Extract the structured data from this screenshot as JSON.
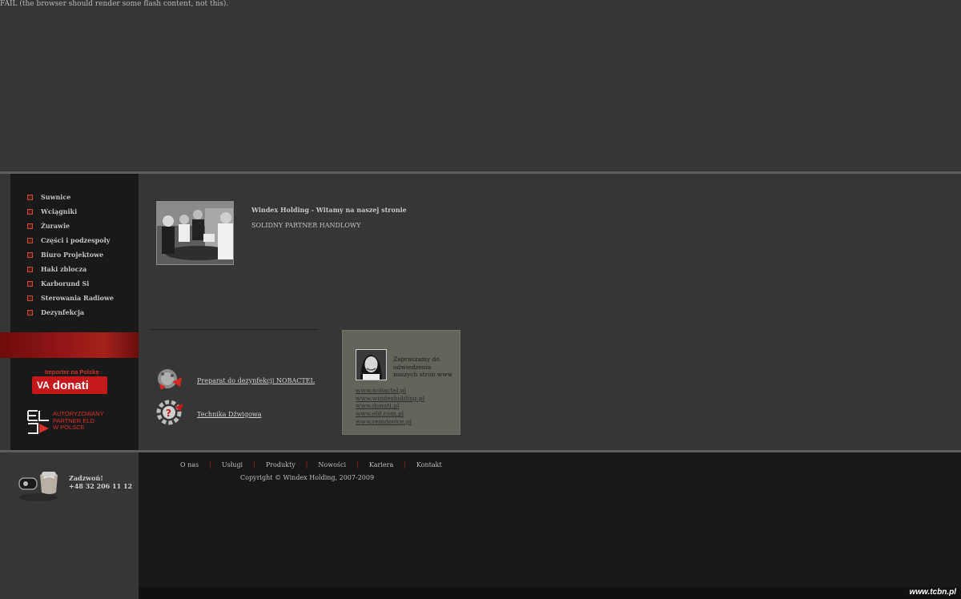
{
  "flash_notice": "FAIL (the browser should render some flash content, not this).",
  "sidebar": {
    "items": [
      {
        "label": "Suwnice"
      },
      {
        "label": "Wciągniki"
      },
      {
        "label": "Żurawie"
      },
      {
        "label": "Części i podzespoły"
      },
      {
        "label": "Biuro Projektowe"
      },
      {
        "label": "Haki zblocza"
      },
      {
        "label": "Karborund Si"
      },
      {
        "label": "Sterowania Radiowe"
      },
      {
        "label": "Dezynfekcja"
      }
    ],
    "donati": {
      "tagline": "Importer na Polskę",
      "wordmark": "donati",
      "mark": "VA"
    },
    "eld": {
      "line1": "AUTORYZOWANY",
      "line2": "PARTNER ELD",
      "line3": "W POLSCE"
    }
  },
  "welcome": {
    "title": "Windex Holding - Witamy na naszej stronie",
    "subtitle": "SOLIDNY PARTNER HANDLOWY"
  },
  "promos": [
    {
      "label": "Preparat do dezynfekcji NOBACTEL",
      "icon": "virus-disinfectant-icon"
    },
    {
      "label": "Technika Dźwigowa",
      "icon": "gear-icon"
    }
  ],
  "visit": {
    "text": "Zapraszamy do odwiedzenia naszych stron www",
    "links": [
      "www.nobactel.pl",
      "www.windexholding.pl",
      "www.donati.pl",
      "www.eld.com.pl",
      "www.remdevice.pl"
    ]
  },
  "contact": {
    "label": "Zadzwoń!",
    "phone": "+48 32 206 11 12"
  },
  "footer": {
    "nav": [
      "O nas",
      "Usługi",
      "Produkty",
      "Nowości",
      "Kariera",
      "Kontakt"
    ],
    "separator": "|",
    "copyright": "Copyright © Windex Holding, 2007-2009"
  },
  "watermark": "www.tcbn.pl",
  "colors": {
    "accent_red": "#c4181b",
    "background": "#363636",
    "sidebar": "#191919",
    "visit_box": "#63635c"
  }
}
